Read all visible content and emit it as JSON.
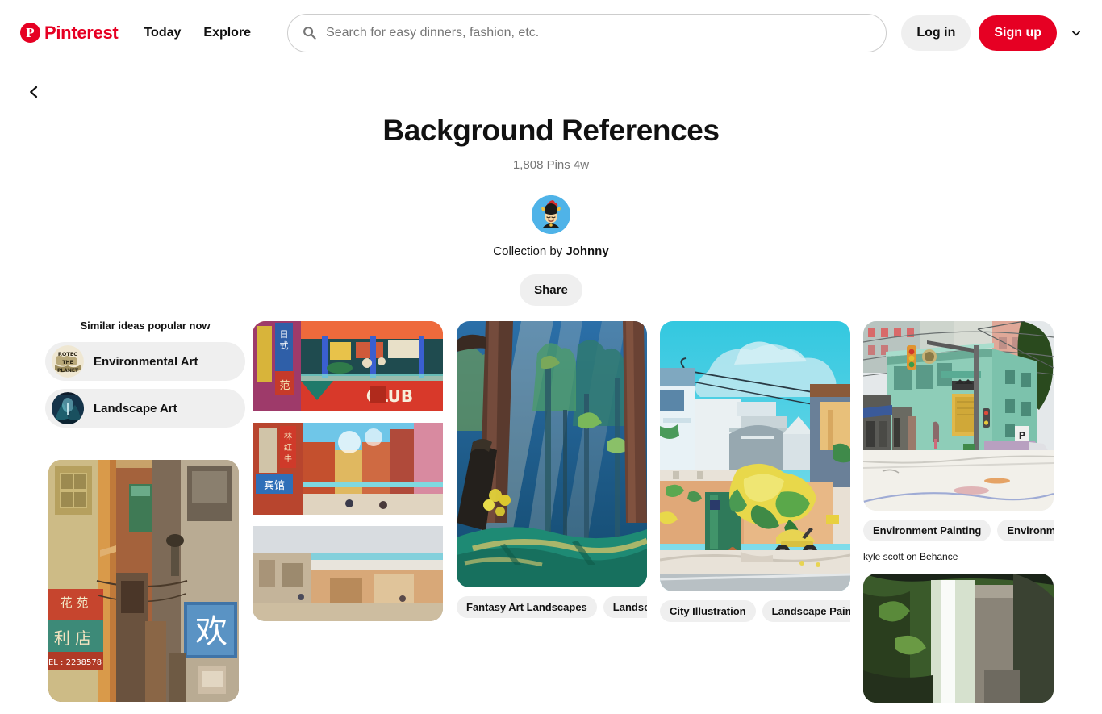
{
  "header": {
    "logo_text": "Pinterest",
    "logo_icon": "pinterest-logo-icon",
    "nav": [
      {
        "label": "Today"
      },
      {
        "label": "Explore"
      }
    ],
    "search": {
      "icon": "search-icon",
      "placeholder": "Search for easy dinners, fashion, etc.",
      "value": ""
    },
    "login_label": "Log in",
    "signup_label": "Sign up",
    "caret_icon": "chevron-down-icon",
    "accent_color": "#e60023"
  },
  "back_icon": "chevron-left-icon",
  "board": {
    "title": "Background References",
    "pin_count": "1,808 Pins",
    "updated": "4w",
    "meta": "1,808 Pins 4w",
    "avatar_name": "johnny-avatar",
    "collection_prefix": "Collection by ",
    "owner": "Johnny",
    "share_label": "Share"
  },
  "similar": {
    "title": "Similar ideas popular now",
    "items": [
      {
        "label": "Environmental Art",
        "thumb": "protect-the-planet-thumb"
      },
      {
        "label": "Landscape Art",
        "thumb": "forest-landscape-thumb"
      }
    ]
  },
  "pins": {
    "col1": [
      {
        "name": "chinese-street-alley-pin",
        "alt": "Warm-lit Chinese street alley with shop signs",
        "tags": [],
        "source": ""
      }
    ],
    "col2": [
      {
        "name": "chinese-city-collage-pin",
        "alt": "Colorful Chinese street collage with CLUB signage",
        "tags": [],
        "source": ""
      }
    ],
    "col3": [
      {
        "name": "fantasy-forest-pin",
        "alt": "Stylized forest with sun rays through tall trees",
        "tags": [
          "Fantasy Art Landscapes",
          "Landscape D"
        ],
        "tag_arrow": "chevron-right-icon",
        "source": ""
      }
    ],
    "col4": [
      {
        "name": "sunny-alley-scooter-pin",
        "alt": "Sunny alley scene with scooter and flowering tree",
        "tags": [
          "City Illustration",
          "Landscape Paintings"
        ],
        "tag_arrow": "chevron-right-icon",
        "source": ""
      }
    ],
    "col5": [
      {
        "name": "green-corner-building-pin",
        "alt": "Green corner building city street with traffic light",
        "tags": [
          "Environment Painting",
          "Environment C"
        ],
        "tag_arrow": "chevron-right-icon",
        "source": "kyle scott on Behance"
      },
      {
        "name": "waterfall-ruins-pin",
        "alt": "Waterfall and stone ruins in green jungle",
        "tags": [],
        "source": ""
      }
    ]
  }
}
